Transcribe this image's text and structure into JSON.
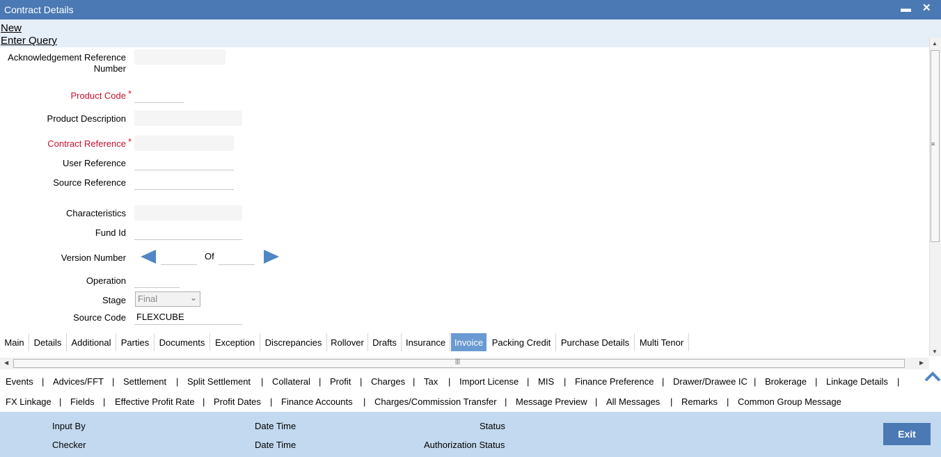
{
  "window": {
    "title": "Contract Details",
    "minimize": "▬",
    "close": "✕"
  },
  "links": {
    "new": "New",
    "enter_query": "Enter Query"
  },
  "form": {
    "ack_ref_label_1": "Acknowledgement Reference",
    "ack_ref_label_2": "Number",
    "product_code_label": "Product Code",
    "product_description_label": "Product Description",
    "contract_reference_label": "Contract Reference",
    "user_reference_label": "User Reference",
    "source_reference_label": "Source Reference",
    "characteristics_label": "Characteristics",
    "fund_id_label": "Fund Id",
    "version_number_label": "Version Number",
    "of_label": "Of",
    "operation_label": "Operation",
    "stage_label": "Stage",
    "stage_value": "Final",
    "source_code_label": "Source Code",
    "source_code_value": "FLEXCUBE",
    "required_marker": "*"
  },
  "tabs": [
    "Main",
    "Details",
    "Additional",
    "Parties",
    "Documents",
    "Exception",
    "Discrepancies",
    "Rollover",
    "Drafts",
    "Insurance",
    "Invoice",
    "Packing Credit",
    "Purchase Details",
    "Multi Tenor"
  ],
  "active_tab": "Invoice",
  "subsystems_row1": [
    "Events",
    "Advices/FFT",
    "Settlement",
    "Split Settlement",
    "Collateral",
    "Profit",
    "Charges",
    "Tax",
    "Import License",
    "MIS",
    "Finance Preference",
    "Drawer/Drawee IC",
    "Brokerage",
    "Linkage Details"
  ],
  "subsystems_row2": [
    "FX Linkage",
    "Fields",
    "Effective Profit Rate",
    "Profit Dates",
    "Finance Accounts",
    "Charges/Commission Transfer",
    "Message Preview",
    "All Messages",
    "Remarks",
    "Common Group Message"
  ],
  "separator": "|",
  "footer": {
    "input_by": "Input By",
    "checker": "Checker",
    "date_time_1": "Date Time",
    "date_time_2": "Date Time",
    "status": "Status",
    "authorization_status": "Authorization Status",
    "exit": "Exit"
  },
  "colors": {
    "title_bar": "#4a79b4",
    "active_tab": "#6a9ad1",
    "footer": "#c3d9ef",
    "required": "#c8102e"
  }
}
